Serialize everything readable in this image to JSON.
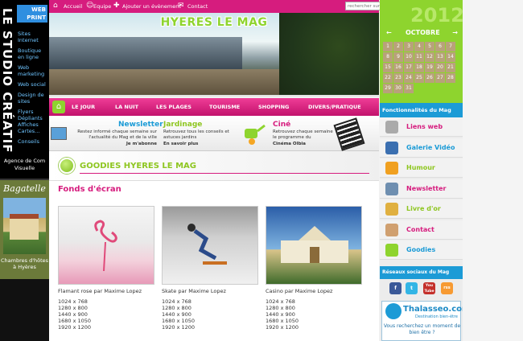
{
  "colors": {
    "pink": "#d61c7e",
    "green": "#8ed42e",
    "blue": "#1c9bd6"
  },
  "left": {
    "brand_vertical": "LE STUDIO CRÉATIF",
    "webprint": "WEB PRINT",
    "menu": [
      "Sites Internet",
      "Boutique en ligne",
      "Web marketing",
      "Web social",
      "Design de sites",
      "Flyers Dépliants Affiches Cartes...",
      "Conseils"
    ],
    "agence": "Agence de Com Visuelle",
    "bagatelle_title": "Bagatelle",
    "bagatelle_caption": "Chambres d'hôtes à Hyères"
  },
  "topbar": {
    "accueil": "Accueil",
    "equipe": "Equipe",
    "ajouter": "Ajouter un évènement",
    "contact": "Contact",
    "search_placeholder": "rechercher sur le mag..."
  },
  "banner": {
    "title": "HYERES LE MAG"
  },
  "nav": [
    "LE JOUR",
    "LA NUIT",
    "LES PLAGES",
    "TOURISME",
    "SHOPPING",
    "DIVERS/PRATIQUE"
  ],
  "features": {
    "newsletter": {
      "title": "Newsletter",
      "text": "Restez informé chaque semaine sur l'actualité du Mag et de la ville",
      "cta": "Je m'abonne"
    },
    "jardinage": {
      "title": "Jardinage",
      "text": "Retrouvez tous les conseils et astuces jardins",
      "cta": "En savoir plus"
    },
    "cine": {
      "title": "Ciné",
      "text": "Retrouvez chaque semaine le programme du",
      "cta": "Cinéma Olbia"
    }
  },
  "goodies": {
    "title": "GOODIES HYERES LE MAG",
    "section": "Fonds d'écran"
  },
  "wallpapers": [
    {
      "caption": "Flamant rose par Maxime Lopez",
      "res": [
        "1024 x 768",
        "1280 x 800",
        "1440 x 900",
        "1680 x 1050",
        "1920 x 1200"
      ]
    },
    {
      "caption": "Skate par Maxime Lopez",
      "res": [
        "1024 x 768",
        "1280 x 800",
        "1440 x 900",
        "1680 x 1050",
        "1920 x 1200"
      ]
    },
    {
      "caption": "Casino par Maxime Lopez",
      "res": [
        "1024 x 768",
        "1280 x 800",
        "1440 x 900",
        "1680 x 1050",
        "1920 x 1200"
      ]
    }
  ],
  "calendar": {
    "year": "2012",
    "month": "OCTOBRE",
    "prev": "←",
    "next": "→",
    "days": [
      "1",
      "2",
      "3",
      "4",
      "5",
      "6",
      "7",
      "8",
      "9",
      "10",
      "11",
      "12",
      "13",
      "14",
      "15",
      "16",
      "17",
      "18",
      "19",
      "20",
      "21",
      "22",
      "23",
      "24",
      "25",
      "26",
      "27",
      "28",
      "29",
      "30",
      "31"
    ]
  },
  "right": {
    "func_head": "Fonctionnalités du Mag",
    "menu": [
      {
        "label": "Liens web",
        "color": "#d61c7e",
        "icon": "link-icon",
        "icon_color": "#aaaaaa"
      },
      {
        "label": "Galerie Vidéo",
        "color": "#1c9bd6",
        "icon": "video-icon",
        "icon_color": "#3b6fb0"
      },
      {
        "label": "Humour",
        "color": "#8ec620",
        "icon": "smile-icon",
        "icon_color": "#f0a020"
      },
      {
        "label": "Newsletter",
        "color": "#d61c7e",
        "icon": "newsletter-icon",
        "icon_color": "#6f8fb0"
      },
      {
        "label": "Livre d'or",
        "color": "#8ec620",
        "icon": "book-icon",
        "icon_color": "#e0b040"
      },
      {
        "label": "Contact",
        "color": "#d61c7e",
        "icon": "mail-icon",
        "icon_color": "#d0a070"
      },
      {
        "label": "Goodies",
        "color": "#1c9bd6",
        "icon": "goodies-icon",
        "icon_color": "#8ed42e"
      }
    ],
    "social_head": "Réseaux sociaux du Mag",
    "social": [
      "f",
      "t",
      "You Tube",
      "rss"
    ],
    "thalasseo": {
      "name": "Thalasseo.com",
      "tag": "Destination bien-être",
      "text": "Vous recherchez un moment de bien être ?"
    }
  }
}
